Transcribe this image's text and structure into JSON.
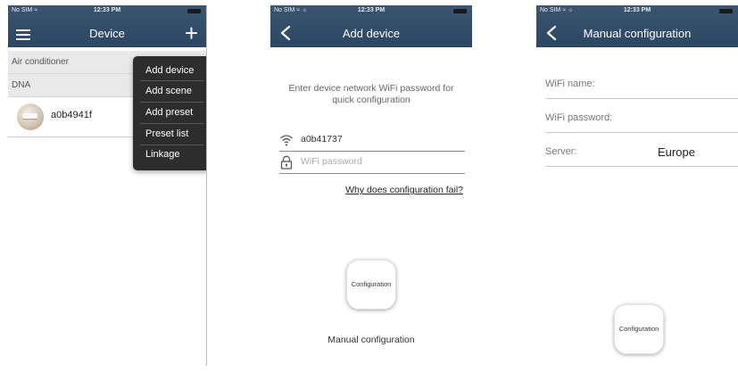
{
  "screens": {
    "device_list": {
      "status": {
        "carrier": "No SIM ≈",
        "time": "12:33 PM"
      },
      "title": "Device",
      "groups": [
        "Air conditioner",
        "DNA"
      ],
      "device": {
        "name": "a0b4941f"
      },
      "menu": {
        "items": [
          "Add device",
          "Add scene",
          "Add preset",
          "Preset list",
          "Linkage"
        ]
      }
    },
    "add_device": {
      "status": {
        "carrier": "No SIM ≈ ☼",
        "time": "12:33 PM"
      },
      "title": "Add device",
      "instruction_line1": "Enter device network WiFi password for",
      "instruction_line2": "quick configuration",
      "wifi_value": "a0b41737",
      "password_placeholder": "WiFi password",
      "help_link": "Why does configuration fail?",
      "config_button": "Configuration",
      "manual_link": "Manual configuration"
    },
    "manual_config": {
      "status": {
        "carrier": "No SIM ≈ ☼",
        "time": "12:33 PM"
      },
      "title": "Manual configuration",
      "wifi_name_label": "WiFi name:",
      "wifi_password_label": "WiFi password:",
      "server_label": "Server:",
      "server_value": "Europe",
      "config_button": "Configuration"
    }
  },
  "colors": {
    "header": "#2f4a66",
    "menu_bg": "#2d2d2d",
    "group_bg": "#e9e9e9"
  }
}
